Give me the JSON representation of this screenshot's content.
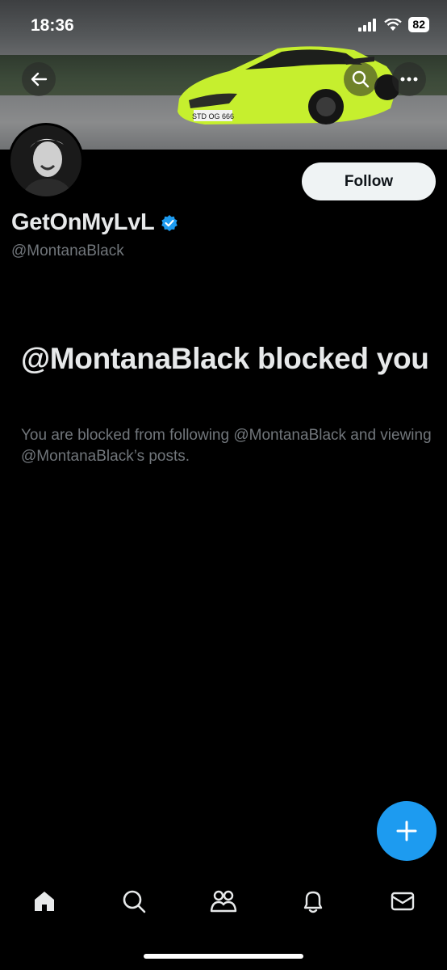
{
  "status_bar": {
    "time": "18:36",
    "battery": "82"
  },
  "banner": {
    "license_plate": "STD OG 666"
  },
  "profile": {
    "display_name": "GetOnMyLvL",
    "handle": "@MontanaBlack",
    "follow_label": "Follow",
    "verified": true
  },
  "blocked": {
    "title": "@MontanaBlack blocked you",
    "description": "You are blocked from following @MontanaBlack and viewing @MontanaBlack’s posts."
  },
  "tabs": [
    {
      "name": "home",
      "icon": "home-icon"
    },
    {
      "name": "search",
      "icon": "search-icon"
    },
    {
      "name": "communities",
      "icon": "communities-icon"
    },
    {
      "name": "notifications",
      "icon": "bell-icon"
    },
    {
      "name": "messages",
      "icon": "mail-icon"
    }
  ],
  "colors": {
    "accent": "#1d9bf0",
    "background": "#000000",
    "secondary_text": "#71767b",
    "car": "#c6ef2e"
  }
}
